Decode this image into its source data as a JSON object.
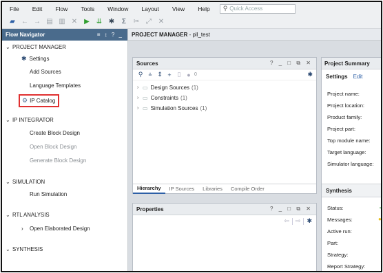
{
  "menubar": {
    "items": [
      "File",
      "Edit",
      "Flow",
      "Tools",
      "Window",
      "Layout",
      "View",
      "Help"
    ],
    "quick_access_placeholder": "Quick Access"
  },
  "flow_navigator": {
    "title": "Flow Navigator",
    "controls": "≡ ↕ ? _",
    "project_manager": {
      "label": "PROJECT MANAGER",
      "items": [
        "Settings",
        "Add Sources",
        "Language Templates",
        "IP Catalog"
      ]
    },
    "ip_integrator": {
      "label": "IP INTEGRATOR",
      "items": [
        "Create Block Design",
        "Open Block Design",
        "Generate Block Design"
      ]
    },
    "simulation": {
      "label": "SIMULATION",
      "items": [
        "Run Simulation"
      ]
    },
    "rtl_analysis": {
      "label": "RTL ANALYSIS",
      "items": [
        "Open Elaborated Design"
      ]
    },
    "synthesis": {
      "label": "SYNTHESIS"
    }
  },
  "project_title": {
    "label": "PROJECT MANAGER",
    "separator": " - ",
    "project_name": "pll_test"
  },
  "sources": {
    "title": "Sources",
    "window_controls": "? _ □ ⧉ ✕",
    "badge_count": "0",
    "tree": [
      {
        "label": "Design Sources",
        "count": "(1)"
      },
      {
        "label": "Constraints",
        "count": "(1)"
      },
      {
        "label": "Simulation Sources",
        "count": "(1)"
      }
    ],
    "tabs": [
      "Hierarchy",
      "IP Sources",
      "Libraries",
      "Compile Order"
    ]
  },
  "properties": {
    "title": "Properties",
    "window_controls": "? _ □ ⧉ ✕"
  },
  "project_summary": {
    "title": "Project Summary",
    "settings_label": "Settings",
    "edit_label": "Edit",
    "fields": [
      "Project name:",
      "Project location:",
      "Product family:",
      "Project part:",
      "Top module name:",
      "Target language:",
      "Simulator language:"
    ],
    "synthesis": {
      "title": "Synthesis",
      "fields": [
        "Status:",
        "Messages:",
        "Active run:",
        "Part:",
        "Strategy:",
        "Report Strategy:"
      ]
    }
  },
  "colors": {
    "nav_header": "#4a6b8c",
    "highlight_box": "#e03030",
    "accent": "#2d5fa6",
    "run_green": "#2f9e2f"
  }
}
